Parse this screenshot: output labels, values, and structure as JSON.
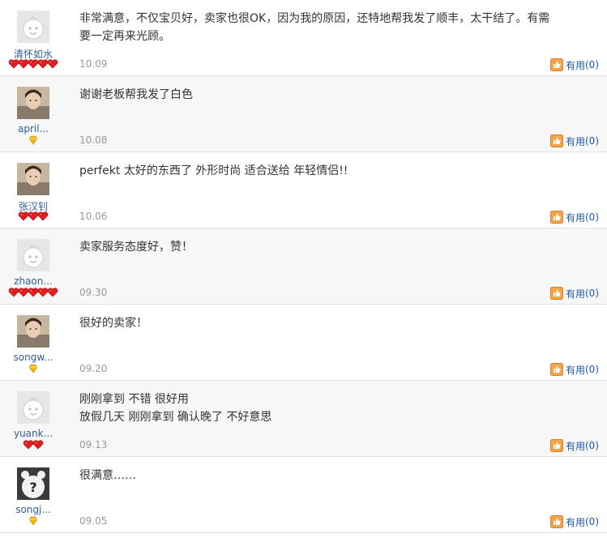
{
  "colors": {
    "username": "#2d5f9a",
    "useful_link": "#1d58a6",
    "heart": "#e02020",
    "diamond": "#f2b600",
    "date": "#999999"
  },
  "reviews": [
    {
      "user": "清怀如水",
      "avatar": "default-avatar",
      "rank_icon": "heart",
      "rank_count": 5,
      "content": "非常满意，不仅宝贝好，卖家也很OK，因为我的原因，还特地帮我发了顺丰，太干结了。有需要一定再来光顾。",
      "date": "10.09",
      "useful_label": "有用",
      "useful_count": "(0)"
    },
    {
      "user": "april...",
      "avatar": "photo-avatar",
      "rank_icon": "diamond",
      "rank_count": 1,
      "content": "谢谢老板帮我发了白色",
      "date": "10.08",
      "useful_label": "有用",
      "useful_count": "(0)"
    },
    {
      "user": "张汉钊",
      "avatar": "photo-avatar",
      "rank_icon": "heart",
      "rank_count": 3,
      "content": "perfekt 太好的东西了 外形时尚 适合送给 年轻情侣!!",
      "date": "10.06",
      "useful_label": "有用",
      "useful_count": "(0)"
    },
    {
      "user": "zhaon...",
      "avatar": "default-avatar",
      "rank_icon": "heart",
      "rank_count": 5,
      "content": "卖家服务态度好，赞！",
      "date": "09.30",
      "useful_label": "有用",
      "useful_count": "(0)"
    },
    {
      "user": "songw...",
      "avatar": "photo-avatar",
      "rank_icon": "diamond",
      "rank_count": 1,
      "content": "很好的卖家！",
      "date": "09.20",
      "useful_label": "有用",
      "useful_count": "(0)"
    },
    {
      "user": "yuank...",
      "avatar": "default-avatar",
      "rank_icon": "heart",
      "rank_count": 2,
      "content": "刚刚拿到 不错 很好用\n放假几天 刚刚拿到 确认晚了 不好意思",
      "date": "09.13",
      "useful_label": "有用",
      "useful_count": "(0)"
    },
    {
      "user": "songj...",
      "avatar": "bear-avatar",
      "rank_icon": "diamond",
      "rank_count": 1,
      "content": "很满意……",
      "date": "09.05",
      "useful_label": "有用",
      "useful_count": "(0)"
    }
  ]
}
